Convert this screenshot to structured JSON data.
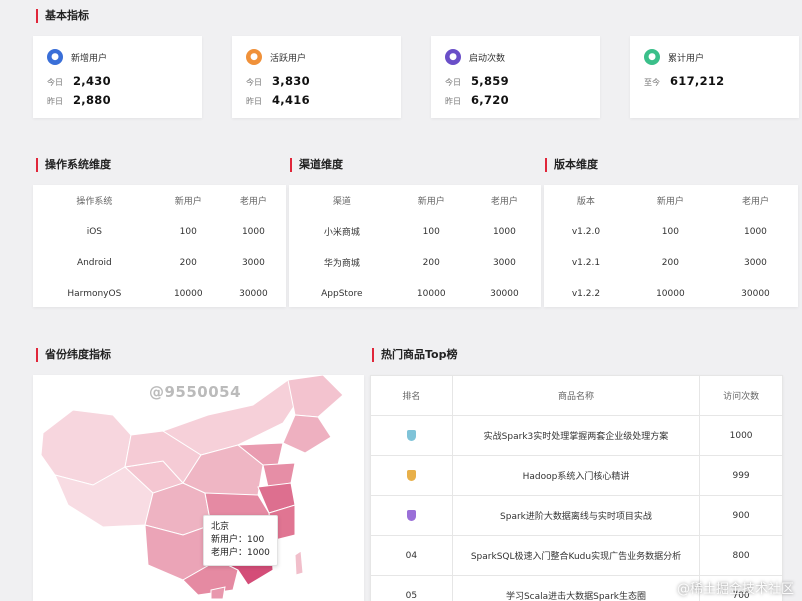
{
  "sections": {
    "basic": "基本指标",
    "os": "操作系统维度",
    "channel": "渠道维度",
    "version": "版本维度",
    "province": "省份纬度指标",
    "top": "热门商品Top榜"
  },
  "metrics": [
    {
      "title": "新增用户",
      "icon": "user-icon",
      "color": "#3a6fd8",
      "rows": [
        {
          "label": "今日",
          "value": "2,430"
        },
        {
          "label": "昨日",
          "value": "2,880"
        }
      ]
    },
    {
      "title": "活跃用户",
      "icon": "active-user-icon",
      "color": "#f0913a",
      "rows": [
        {
          "label": "今日",
          "value": "3,830"
        },
        {
          "label": "昨日",
          "value": "4,416"
        }
      ]
    },
    {
      "title": "启动次数",
      "icon": "launch-icon",
      "color": "#6a4fc8",
      "rows": [
        {
          "label": "今日",
          "value": "5,859"
        },
        {
          "label": "昨日",
          "value": "6,720"
        }
      ]
    },
    {
      "title": "累计用户",
      "icon": "total-users-icon",
      "color": "#3bbf8a",
      "rows": [
        {
          "label": "至今",
          "value": "617,212"
        }
      ]
    }
  ],
  "os_table": {
    "headers": [
      "操作系统",
      "新用户",
      "老用户"
    ],
    "rows": [
      [
        "iOS",
        "100",
        "1000"
      ],
      [
        "Android",
        "200",
        "3000"
      ],
      [
        "HarmonyOS",
        "10000",
        "30000"
      ]
    ]
  },
  "channel_table": {
    "headers": [
      "渠道",
      "新用户",
      "老用户"
    ],
    "rows": [
      [
        "小米商城",
        "100",
        "1000"
      ],
      [
        "华为商城",
        "200",
        "3000"
      ],
      [
        "AppStore",
        "10000",
        "30000"
      ]
    ]
  },
  "version_table": {
    "headers": [
      "版本",
      "新用户",
      "老用户"
    ],
    "rows": [
      [
        "v1.2.0",
        "100",
        "1000"
      ],
      [
        "v1.2.1",
        "200",
        "3000"
      ],
      [
        "v1.2.2",
        "10000",
        "30000"
      ]
    ]
  },
  "map": {
    "watermark": "@9550054",
    "tooltip": {
      "region": "北京",
      "new_users": "新用户：100",
      "old_users": "老用户：1000"
    }
  },
  "top_table": {
    "headers": [
      "排名",
      "商品名称",
      "访问次数"
    ],
    "rows": [
      {
        "rank": "",
        "medal": "#7fc3d8",
        "name": "实战Spark3实时处理掌握两套企业级处理方案",
        "count": "1000"
      },
      {
        "rank": "",
        "medal": "#e8b04a",
        "name": "Hadoop系统入门核心精讲",
        "count": "999"
      },
      {
        "rank": "",
        "medal": "#9a6fd8",
        "name": "Spark进阶大数据离线与实时项目实战",
        "count": "900"
      },
      {
        "rank": "04",
        "medal": "",
        "name": "SparkSQL极速入门整合Kudu实现广告业务数据分析",
        "count": "800"
      },
      {
        "rank": "05",
        "medal": "",
        "name": "学习Scala进击大数据Spark生态圈",
        "count": "700"
      }
    ]
  },
  "corner_watermark": "@稀土掘金技术社区"
}
